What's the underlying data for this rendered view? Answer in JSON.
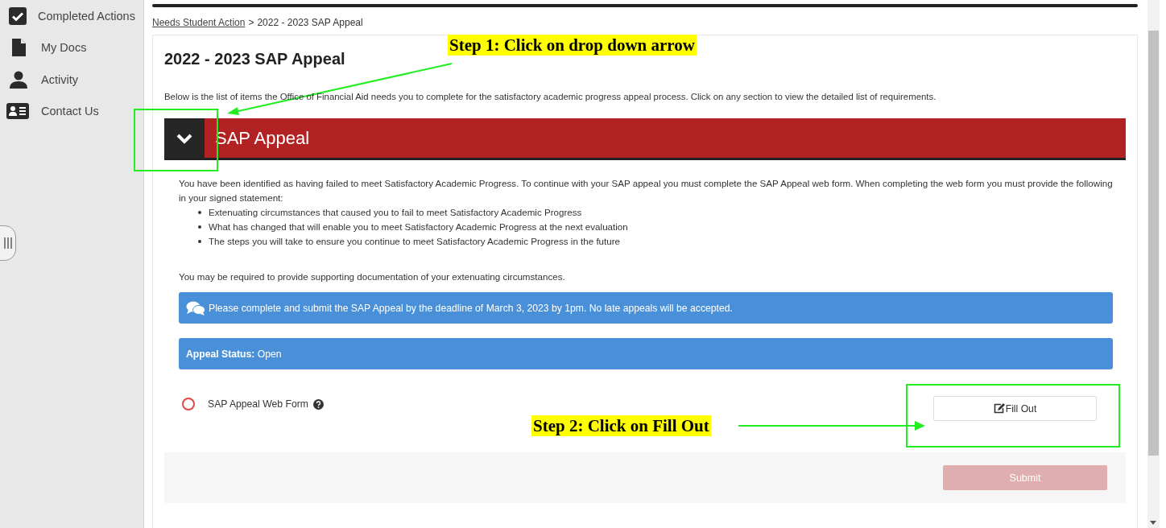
{
  "sidebar": {
    "items": [
      {
        "label": "Completed Actions"
      },
      {
        "label": "My Docs"
      },
      {
        "label": "Activity"
      },
      {
        "label": "Contact Us"
      }
    ]
  },
  "breadcrumb": {
    "link": "Needs Student Action",
    "separator": ">",
    "current": "2022 - 2023 SAP Appeal"
  },
  "page": {
    "title": "2022 - 2023 SAP Appeal",
    "intro": "Below is the list of items the Office of Financial Aid needs you to complete for the satisfactory academic progress appeal process. Click on any section to view the detailed list of requirements."
  },
  "section": {
    "title": "SAP Appeal",
    "expanded": true,
    "text": "You have been identified as having failed to meet Satisfactory Academic Progress. To continue with your SAP appeal you must complete the SAP Appeal web form. When completing the web form you must provide the following in your signed statement:",
    "bullets": [
      "Extenuating circumstances that caused you to fail to meet Satisfactory Academic Progress",
      "What has changed that will enable you to meet Satisfactory Academic Progress at the next evaluation",
      "The steps you will take to ensure you continue to meet Satisfactory Academic Progress in the future"
    ],
    "note": "You may be required to provide supporting documentation of your extenuating circumstances.",
    "alert": "Please complete and submit the SAP Appeal by the deadline of March 3, 2023 by 1pm. No late appeals will be accepted.",
    "status": "**Appeal Status:** Open",
    "requirements": [
      {
        "label": "SAP Appeal Web Form",
        "completed": false,
        "button": "Fill Out"
      }
    ],
    "submit": {
      "label": "Submit",
      "disabled": true
    }
  },
  "annotations": [
    {
      "text": "Step 1: Click on drop down arrow"
    },
    {
      "text": "Step 2: Click on Fill Out"
    }
  ]
}
